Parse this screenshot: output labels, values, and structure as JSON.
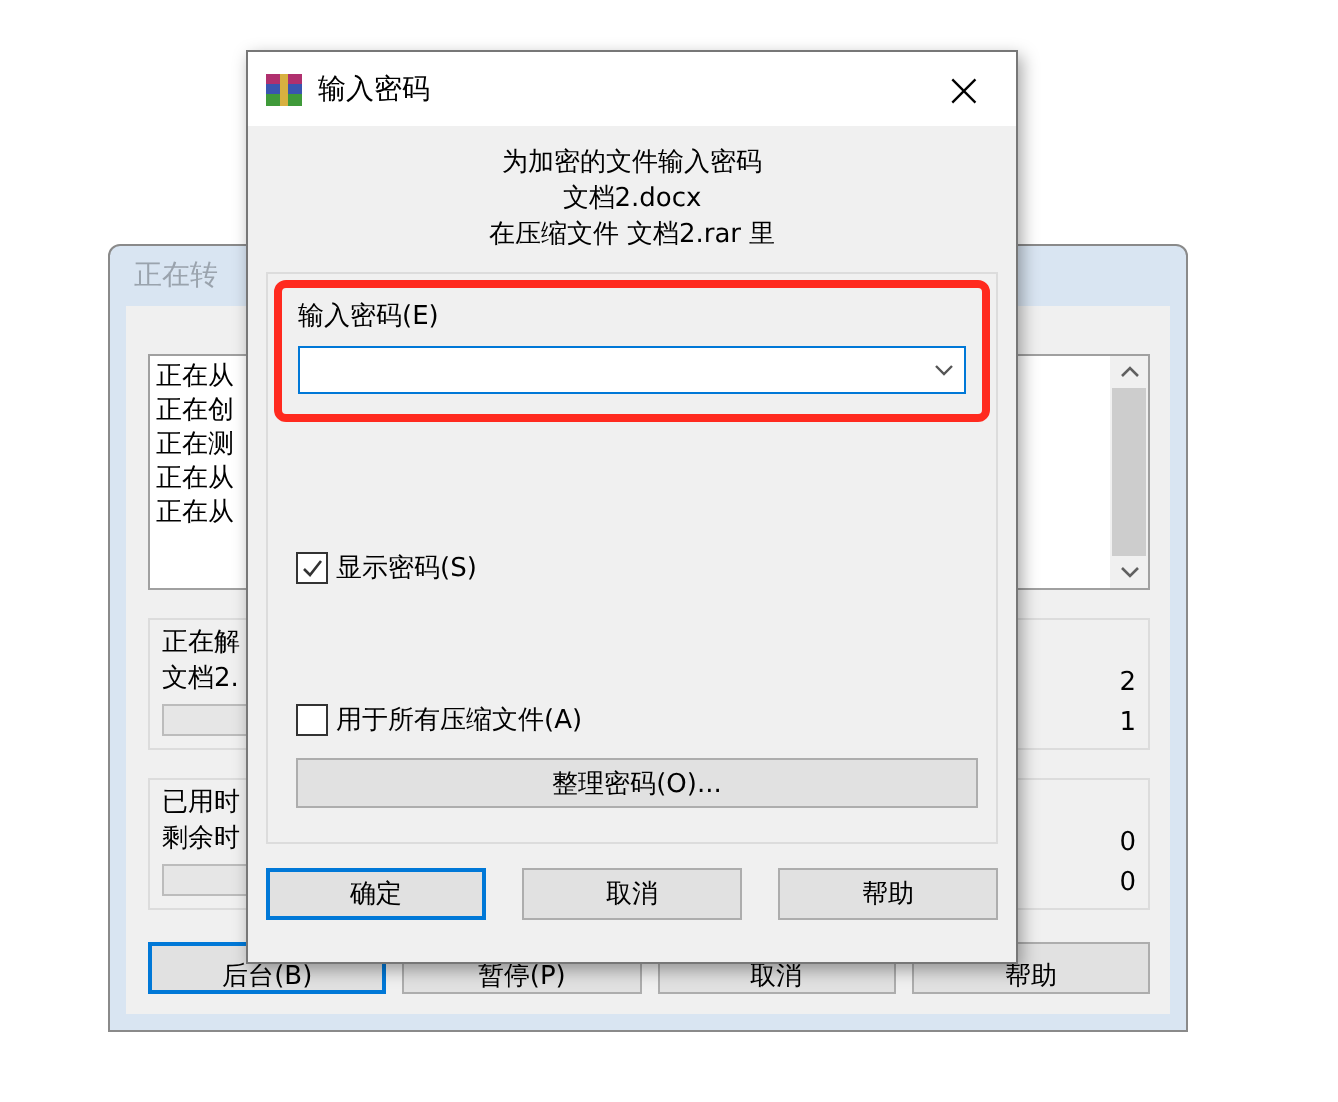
{
  "background_window": {
    "title": "正在转",
    "log_lines": [
      "正在从",
      "正在创",
      "正在测",
      "正在从",
      "正在从"
    ],
    "progress_group": {
      "lines": [
        "正在解",
        "文档2."
      ],
      "counts": [
        "2",
        "1"
      ],
      "level": 0
    },
    "time_group": {
      "lines": [
        "已用时",
        "剩余时"
      ],
      "counts": [
        "0",
        "0"
      ],
      "level": 0
    },
    "buttons": [
      {
        "label": "后台(B)",
        "selected": true
      },
      {
        "label": "暂停(P)",
        "selected": false
      },
      {
        "label": "取消",
        "selected": false
      },
      {
        "label": "帮助",
        "selected": false
      }
    ]
  },
  "dialog": {
    "title": "输入密码",
    "close": "×",
    "message": [
      "为加密的文件输入密码",
      "文档2.docx",
      "在压缩文件 文档2.rar 里"
    ],
    "password_label": "输入密码(E)",
    "password_highlighted": true,
    "show_password": {
      "label": "显示密码(S)",
      "checked": true
    },
    "use_for_all": {
      "label": "用于所有压缩文件(A)",
      "checked": false
    },
    "organize_button": "整理密码(O)...",
    "buttons": [
      {
        "label": "确定",
        "selected": true
      },
      {
        "label": "取消",
        "selected": false
      },
      {
        "label": "帮助",
        "selected": false
      }
    ]
  }
}
